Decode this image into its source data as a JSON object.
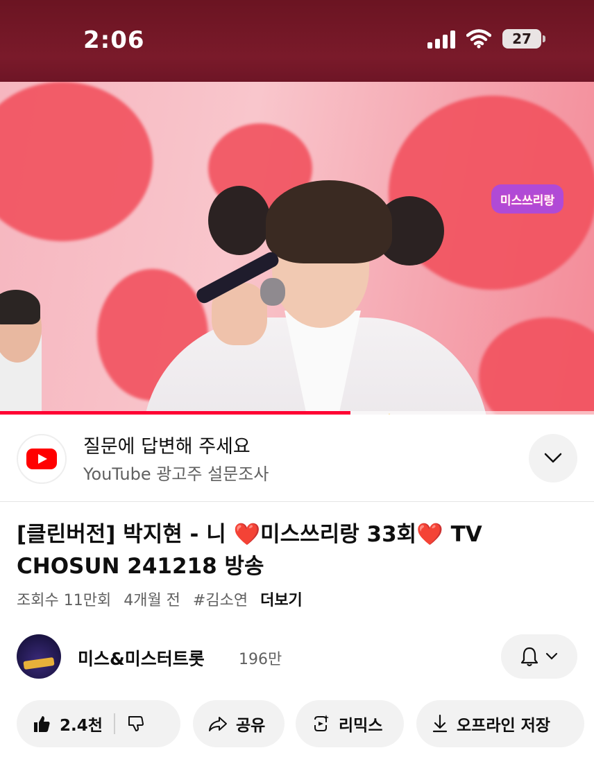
{
  "status_bar": {
    "time": "2:06",
    "battery_level": "27",
    "signal_bars": 4,
    "wifi": true
  },
  "video": {
    "channel_overlay_logo": "미스쓰리랑",
    "progress_fraction": 0.59,
    "accent_color": "#ff0033"
  },
  "ad": {
    "title": "질문에 답변해 주세요",
    "subtitle": "YouTube 광고주 설문조사",
    "icon": "youtube-logo-icon",
    "expand_icon": "chevron-down-icon"
  },
  "title": {
    "text": "[클린버전] 박지현 - 니 ❤️미스쓰리랑 33회❤️ TV CHOSUN 241218 방송"
  },
  "meta": {
    "views": "조회수 11만회",
    "age": "4개월 전",
    "hashtag": "#김소연",
    "more": "더보기"
  },
  "channel": {
    "name": "미스&미스터트롯",
    "subscribers": "196만",
    "bell_icon": "bell-icon",
    "dropdown_icon": "chevron-down-icon"
  },
  "actions": {
    "like_count": "2.4천",
    "share": "공유",
    "remix": "리믹스",
    "download": "오프라인 저장"
  }
}
